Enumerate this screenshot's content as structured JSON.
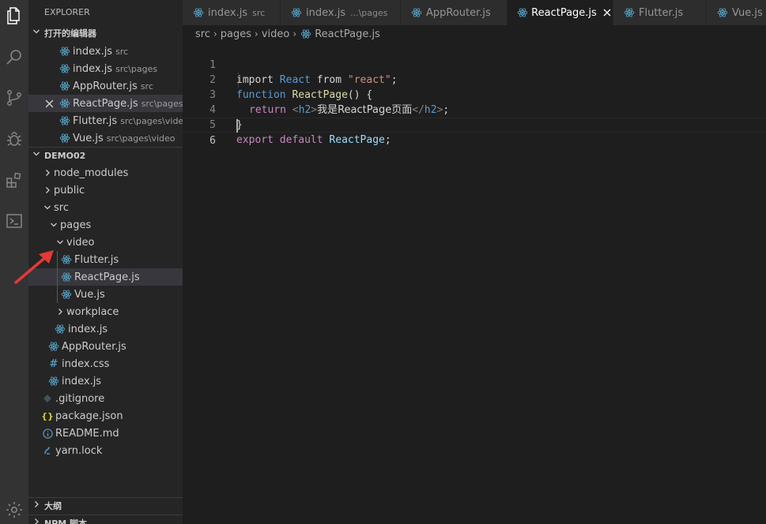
{
  "sidebar": {
    "title": "EXPLORER",
    "open_editors_header": "打开的编辑器",
    "open_editors": [
      {
        "name": "index.js",
        "desc": "src"
      },
      {
        "name": "index.js",
        "desc": "src\\pages"
      },
      {
        "name": "AppRouter.js",
        "desc": "src"
      },
      {
        "name": "ReactPage.js",
        "desc": "src\\pages..."
      },
      {
        "name": "Flutter.js",
        "desc": "src\\pages\\video"
      },
      {
        "name": "Vue.js",
        "desc": "src\\pages\\video"
      }
    ],
    "project_header": "DEMO02",
    "tree": [
      {
        "name": "node_modules"
      },
      {
        "name": "public"
      },
      {
        "name": "src"
      },
      {
        "name": "pages"
      },
      {
        "name": "video"
      },
      {
        "name": "Flutter.js"
      },
      {
        "name": "ReactPage.js"
      },
      {
        "name": "Vue.js"
      },
      {
        "name": "workplace"
      },
      {
        "name": "index.js"
      },
      {
        "name": "AppRouter.js"
      },
      {
        "name": "index.css"
      },
      {
        "name": "index.js"
      },
      {
        "name": ".gitignore"
      },
      {
        "name": "package.json"
      },
      {
        "name": "README.md"
      },
      {
        "name": "yarn.lock"
      }
    ],
    "outline_header": "大纲",
    "npm_header": "NPM 脚本"
  },
  "tabs": [
    {
      "name": "index.js",
      "desc": "src"
    },
    {
      "name": "index.js",
      "desc": "...\\pages"
    },
    {
      "name": "AppRouter.js",
      "desc": ""
    },
    {
      "name": "ReactPage.js",
      "desc": ""
    },
    {
      "name": "Flutter.js",
      "desc": ""
    },
    {
      "name": "Vue.js",
      "desc": ""
    }
  ],
  "breadcrumb": [
    "src",
    "pages",
    "video",
    "ReactPage.js"
  ],
  "editor": {
    "line_numbers": [
      "1",
      "2",
      "3",
      "4",
      "5",
      "6"
    ],
    "tokens": {
      "l1": [
        "import",
        " React",
        " from",
        " \"react\"",
        ";"
      ],
      "l2": [
        "function",
        " ReactPage",
        "() {"
      ],
      "l3": [
        "return",
        " <",
        "h2",
        ">",
        "我是ReactPage页面",
        "</",
        "h2",
        ">",
        ";"
      ],
      "l4": [
        "}"
      ],
      "l5": [
        "export",
        " default",
        " ReactPage",
        ";"
      ]
    }
  },
  "colors": {
    "activity_bar": "#333333",
    "sidebar": "#252526",
    "editor": "#1e1e1e",
    "react_icon": "#519aba",
    "arrow": "#e53935"
  }
}
